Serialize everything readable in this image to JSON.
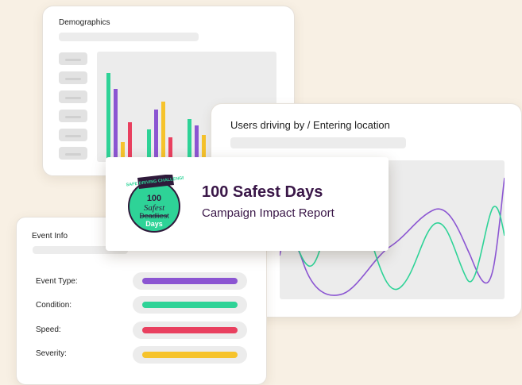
{
  "demographics": {
    "title": "Demographics",
    "groups": [
      {
        "bars": [
          {
            "color": "#2ed397",
            "level": 1.0
          },
          {
            "color": "#8b55d2",
            "level": 0.82
          },
          {
            "color": "#f6c32c",
            "level": 0.22
          },
          {
            "color": "#e9405f",
            "level": 0.45
          }
        ]
      },
      {
        "bars": [
          {
            "color": "#2ed397",
            "level": 0.37
          },
          {
            "color": "#8b55d2",
            "level": 0.59
          },
          {
            "color": "#f6c32c",
            "level": 0.68
          },
          {
            "color": "#e9405f",
            "level": 0.28
          }
        ]
      },
      {
        "bars": [
          {
            "color": "#2ed397",
            "level": 0.48
          },
          {
            "color": "#8b55d2",
            "level": 0.41
          },
          {
            "color": "#f6c32c",
            "level": 0.3
          },
          {
            "color": "#e9405f",
            "level": 0.0
          }
        ]
      }
    ]
  },
  "users_chart": {
    "title": "Users driving by / Entering location",
    "series": [
      {
        "color": "#8b55d2"
      },
      {
        "color": "#2ed397"
      }
    ]
  },
  "event_info": {
    "title": "Event Info",
    "rows": [
      {
        "label": "Event Type:",
        "color": "#8b55d2",
        "fill": 0.9
      },
      {
        "label": "Condition:",
        "color": "#2ed397",
        "fill": 0.9
      },
      {
        "label": "Speed:",
        "color": "#e9405f",
        "fill": 0.9
      },
      {
        "label": "Severity:",
        "color": "#f6c32c",
        "fill": 0.9
      }
    ]
  },
  "hero": {
    "title": "100 Safest Days",
    "subtitle": "Campaign Impact Report",
    "logo": {
      "banner_text": "SAFE DRIVING CHALLENGE",
      "number": "100",
      "script_word": "Safest",
      "struck_word": "Deadliest",
      "bottom_word": "Days",
      "badge_color": "#2ed397",
      "banner_color": "#2f1a3b"
    }
  }
}
